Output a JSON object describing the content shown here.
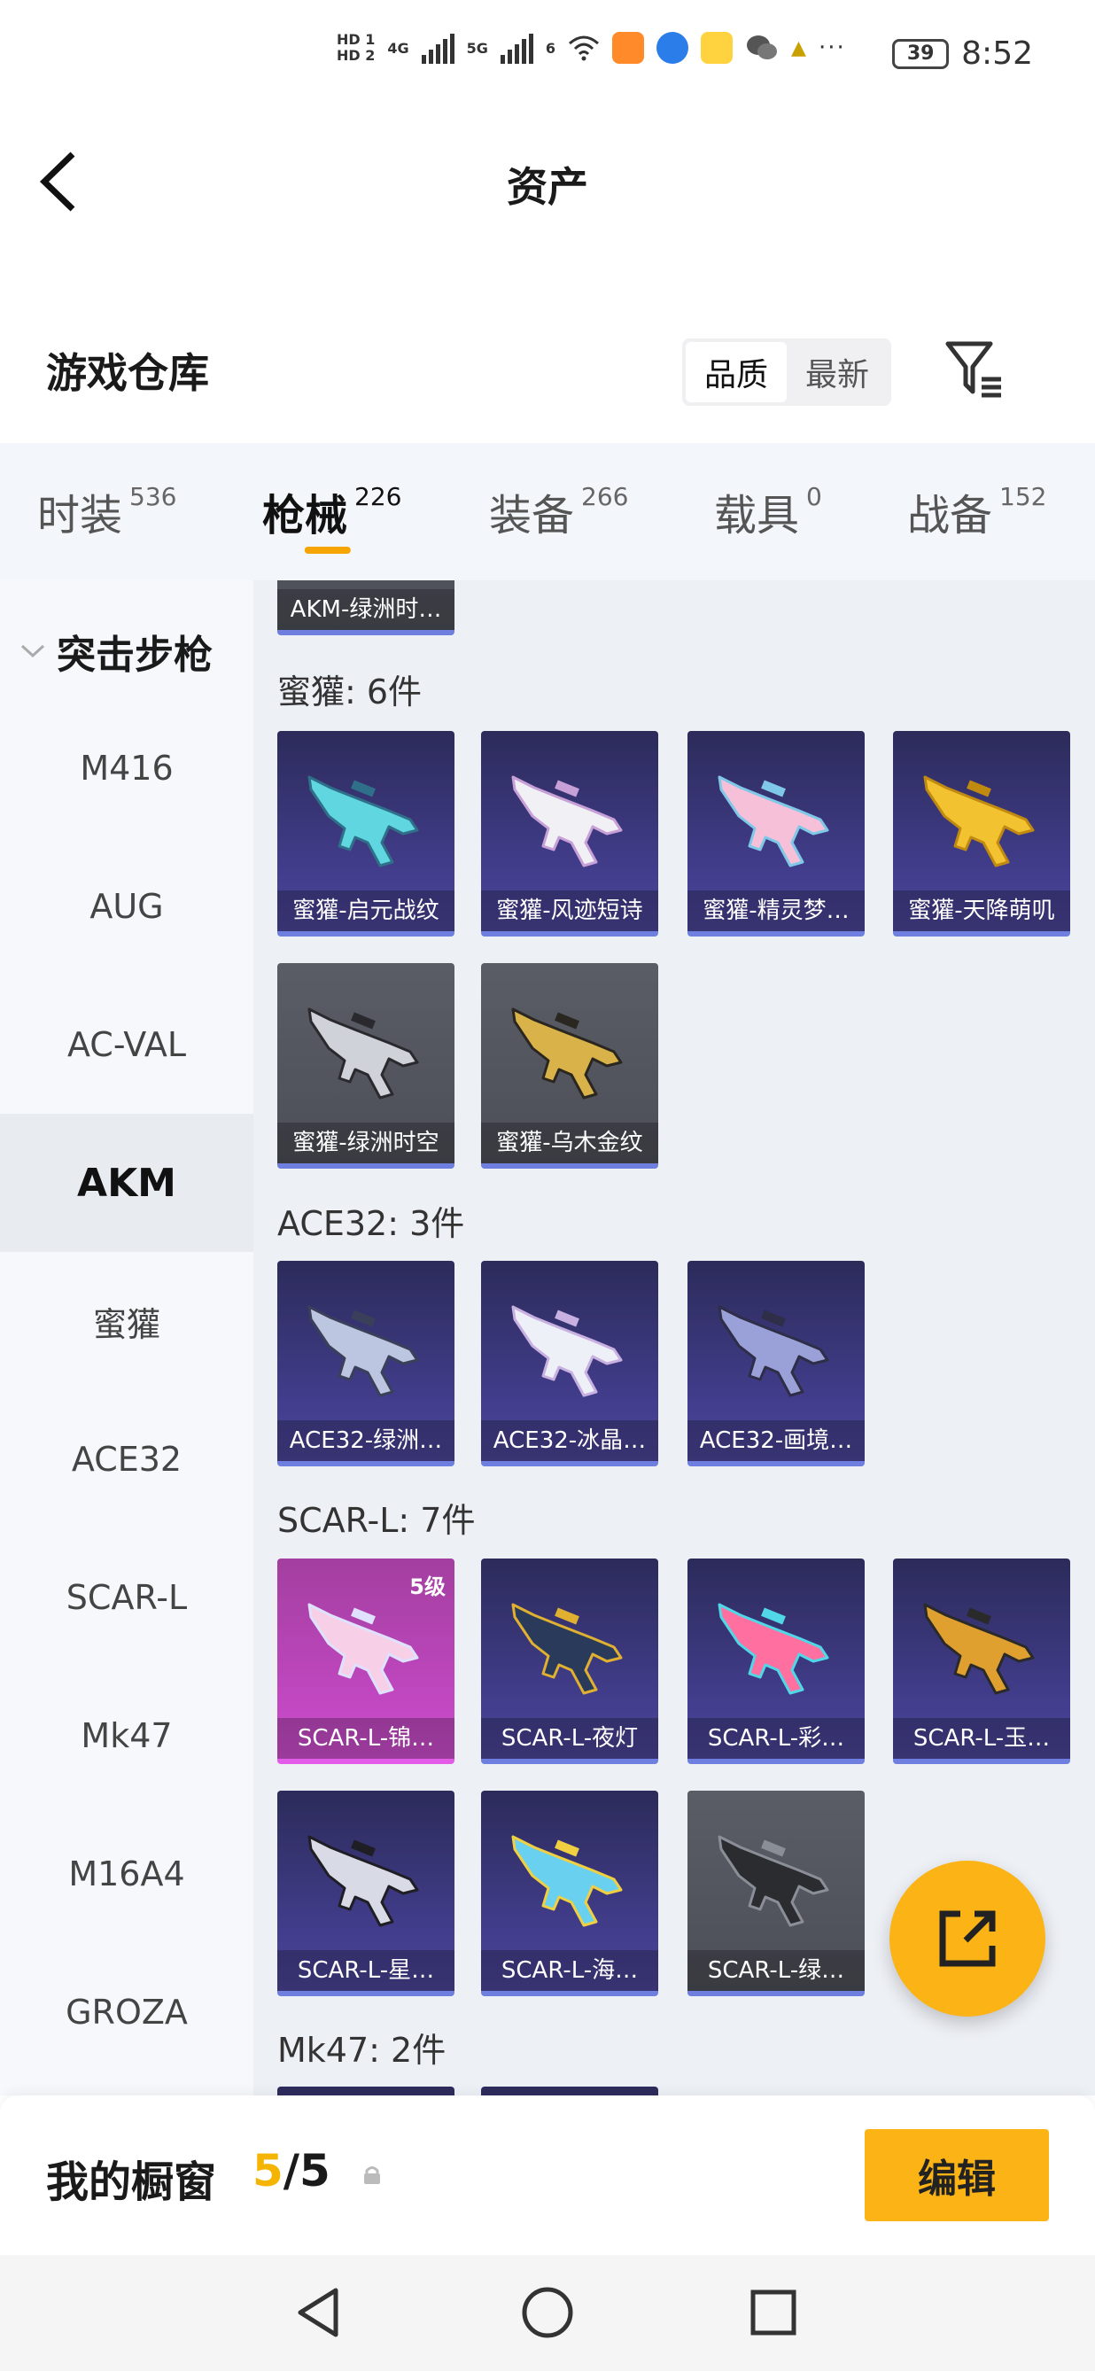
{
  "status_bar": {
    "hd1": "HD 1",
    "hd2": "HD 2",
    "net1": "4G",
    "net2": "5G",
    "net3": "6",
    "more": "···",
    "battery": "39",
    "time": "8:52"
  },
  "header": {
    "title": "资产"
  },
  "warehouse": {
    "title": "游戏仓库",
    "sort_options": [
      "品质",
      "最新"
    ],
    "active_sort": "品质"
  },
  "tabs": [
    {
      "label": "时装",
      "count": "536"
    },
    {
      "label": "枪械",
      "count": "226"
    },
    {
      "label": "装备",
      "count": "266"
    },
    {
      "label": "载具",
      "count": "0"
    },
    {
      "label": "战备",
      "count": "152"
    }
  ],
  "sidebar": {
    "group": "突击步枪",
    "items": [
      "M416",
      "AUG",
      "AC-VAL",
      "AKM",
      "蜜獾",
      "ACE32",
      "SCAR-L",
      "Mk47",
      "M16A4",
      "GROZA"
    ],
    "active": "AKM"
  },
  "sections": {
    "top_card": "AKM-绿洲时…",
    "honeybadger": {
      "title": "蜜獾: 6件",
      "cards": [
        "蜜獾-启元战纹",
        "蜜獾-风迹短诗",
        "蜜獾-精灵梦…",
        "蜜獾-天降萌叽",
        "蜜獾-绿洲时空",
        "蜜獾-乌木金纹"
      ]
    },
    "ace32": {
      "title": "ACE32: 3件",
      "cards": [
        "ACE32-绿洲…",
        "ACE32-冰晶…",
        "ACE32-画境…"
      ]
    },
    "scarl": {
      "title": "SCAR-L: 7件",
      "level_badge": "5级",
      "cards": [
        "SCAR-L-锦…",
        "SCAR-L-夜灯",
        "SCAR-L-彩…",
        "SCAR-L-玉…",
        "SCAR-L-星…",
        "SCAR-L-海…",
        "SCAR-L-绿…"
      ]
    },
    "mk47": {
      "title": "Mk47: 2件"
    }
  },
  "showcase": {
    "label": "我的橱窗",
    "current": "5",
    "sep_total": "/5",
    "edit_label": "编辑"
  },
  "colors": {
    "accent": "#fbb315",
    "tab_underline": "#f5a400"
  }
}
